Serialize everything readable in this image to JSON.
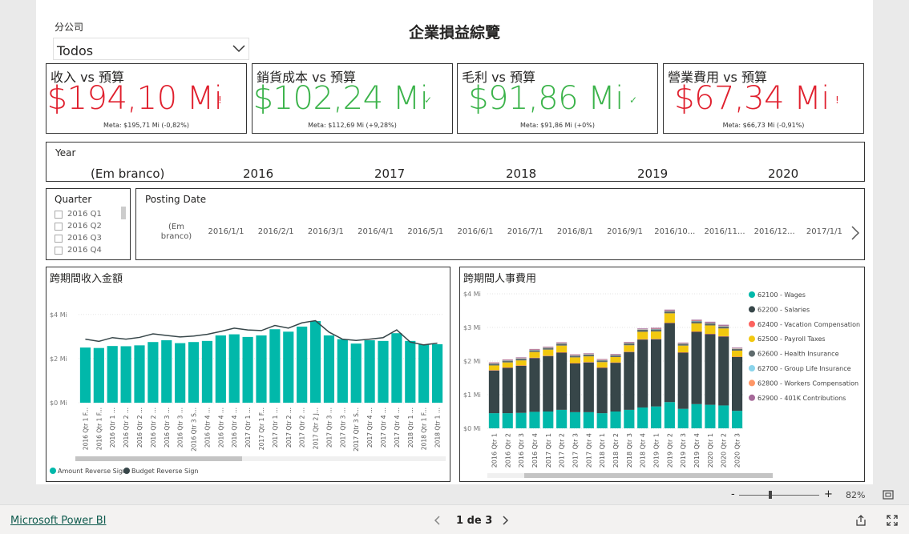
{
  "report": {
    "title": "企業損益綜覽",
    "subsidiary_label": "分公司",
    "subsidiary_value": "Todos"
  },
  "kpis": [
    {
      "title": "收入 vs 預算",
      "value": "$194,10 Mi",
      "mark": "!",
      "meta": "Meta: $195,71 Mi (-0,82%)",
      "color": "#e0202e"
    },
    {
      "title": "銷貨成本 vs 預算",
      "value": "$102,24 Mi",
      "mark": "✓",
      "meta": "Meta: $112,69 Mi (+9,28%)",
      "color": "#3bb34a"
    },
    {
      "title": "毛利 vs 預算",
      "value": "$91,86 Mi",
      "mark": "✓",
      "meta": "Meta: $91,86 Mi (+0%)",
      "color": "#3bb34a"
    },
    {
      "title": "營業費用 vs 預算",
      "value": "$67,34 Mi",
      "mark": "!",
      "meta": "Meta: $66,73 Mi (-0,91%)",
      "color": "#e0202e"
    }
  ],
  "year_slicer": {
    "title": "Year",
    "items": [
      "(Em branco)",
      "2016",
      "2017",
      "2018",
      "2019",
      "2020"
    ]
  },
  "quarter_slicer": {
    "title": "Quarter",
    "items": [
      "2016 Q1",
      "2016 Q2",
      "2016 Q3",
      "2016 Q4"
    ]
  },
  "date_slicer": {
    "title": "Posting Date",
    "items": [
      "(Em\nbranco)",
      "2016/1/1",
      "2016/2/1",
      "2016/3/1",
      "2016/4/1",
      "2016/5/1",
      "2016/6/1",
      "2016/7/1",
      "2016/8/1",
      "2016/9/1",
      "2016/10...",
      "2016/11...",
      "2016/12...",
      "2017/1/1"
    ]
  },
  "chart_data": [
    {
      "type": "bar",
      "title": "跨期間收入金額",
      "categories": [
        "2016 Qtr 1 F...",
        "2016 Qtr 1 F...",
        "2016 Qtr 1 ...",
        "2016 Qtr 2 ...",
        "2016 Qtr 2 ...",
        "2016 Qtr 2 ...",
        "2016 Qtr 3 ...",
        "2016 Qtr 3 ...",
        "2016 Qtr 3 S...",
        "2016 Qtr 4 ...",
        "2016 Qtr 4 ...",
        "2016 Qtr 4 ...",
        "2017 Qtr 1 ...",
        "2017 Qtr 1 F...",
        "2017 Qtr 1 ...",
        "2017 Qtr 2 ...",
        "2017 Qtr 2 ...",
        "2017 Qtr 2 J...",
        "2017 Qtr 3 ...",
        "2017 Qtr 3 ...",
        "2017 Qtr 3 S...",
        "2017 Qtr 4 ...",
        "2017 Qtr 4 ...",
        "2017 Qtr 4 ...",
        "2018 Qtr 1 ...",
        "2018 Qtr 1 F...",
        "2018 Qtr 1 ..."
      ],
      "series": [
        {
          "name": "Amount Reverse Sign",
          "values": [
            2.5,
            2.48,
            2.57,
            2.56,
            2.6,
            2.75,
            2.83,
            2.7,
            2.75,
            2.8,
            3.05,
            3.1,
            2.98,
            3.05,
            3.33,
            3.22,
            3.45,
            3.7,
            3.05,
            2.88,
            2.68,
            2.83,
            2.8,
            3.15,
            2.8,
            2.65,
            2.65
          ]
        },
        {
          "name": "Budget Reverse Sign",
          "values": [
            2.88,
            2.78,
            2.95,
            2.88,
            2.96,
            3.12,
            3.05,
            2.98,
            3.02,
            3.1,
            3.23,
            3.38,
            3.3,
            3.27,
            3.5,
            3.38,
            3.62,
            3.72,
            3.2,
            2.88,
            2.82,
            2.88,
            2.95,
            3.3,
            2.75,
            2.62,
            2.7
          ]
        }
      ],
      "yticks": [
        "$0 Mi",
        "$2 Mi",
        "$4 Mi"
      ],
      "ylim": [
        0,
        4.5
      ]
    },
    {
      "type": "bar",
      "stacked": true,
      "title": "跨期間人事費用",
      "categories": [
        "2016 Qtr 1",
        "2016 Qtr 2",
        "2016 Qtr 3",
        "2016 Qtr 4",
        "2017 Qtr 1",
        "2017 Qtr 2",
        "2017 Qtr 3",
        "2017 Qtr 4",
        "2018 Qtr 1",
        "2018 Qtr 2",
        "2018 Qtr 3",
        "2018 Qtr 4",
        "2019 Qtr 1",
        "2019 Qtr 2",
        "2019 Qtr 3",
        "2019 Qtr 4",
        "2020 Qtr 1",
        "2020 Qtr 2",
        "2020 Qtr 3"
      ],
      "series": [
        {
          "name": "62100 - Wages",
          "color": "#01b8aa",
          "values": [
            0.45,
            0.45,
            0.46,
            0.49,
            0.5,
            0.55,
            0.48,
            0.48,
            0.45,
            0.5,
            0.55,
            0.62,
            0.65,
            0.78,
            0.58,
            0.72,
            0.7,
            0.68,
            0.52
          ]
        },
        {
          "name": "62200 - Salaries",
          "color": "#374649",
          "values": [
            1.27,
            1.35,
            1.4,
            1.6,
            1.65,
            1.7,
            1.45,
            1.48,
            1.35,
            1.45,
            1.72,
            2.02,
            2.0,
            2.35,
            1.67,
            2.15,
            2.1,
            2.05,
            1.6
          ]
        },
        {
          "name": "62400 - Vacation Compensation",
          "color": "#fd625e",
          "values": [
            0.01,
            0.01,
            0.01,
            0.01,
            0.01,
            0.01,
            0.01,
            0.01,
            0.01,
            0.01,
            0.01,
            0.01,
            0.01,
            0.01,
            0.01,
            0.01,
            0.01,
            0.01,
            0.01
          ]
        },
        {
          "name": "62500 - Payroll Taxes",
          "color": "#f2c80f",
          "values": [
            0.14,
            0.15,
            0.15,
            0.17,
            0.18,
            0.2,
            0.17,
            0.17,
            0.16,
            0.16,
            0.19,
            0.22,
            0.22,
            0.28,
            0.2,
            0.24,
            0.25,
            0.23,
            0.18
          ]
        },
        {
          "name": "62600 - Health Insurance",
          "color": "#5f6b6d",
          "values": [
            0.05,
            0.05,
            0.05,
            0.05,
            0.05,
            0.06,
            0.05,
            0.05,
            0.05,
            0.05,
            0.06,
            0.06,
            0.06,
            0.06,
            0.05,
            0.06,
            0.06,
            0.06,
            0.05
          ]
        },
        {
          "name": "62700 - Group Life Insurance",
          "color": "#8ad4eb",
          "values": [
            0.01,
            0.01,
            0.01,
            0.01,
            0.01,
            0.01,
            0.01,
            0.01,
            0.01,
            0.01,
            0.01,
            0.01,
            0.01,
            0.01,
            0.01,
            0.01,
            0.01,
            0.01,
            0.01
          ]
        },
        {
          "name": "62800 - Workers Compensation",
          "color": "#fe9666",
          "values": [
            0.01,
            0.01,
            0.01,
            0.01,
            0.01,
            0.01,
            0.01,
            0.01,
            0.01,
            0.01,
            0.01,
            0.01,
            0.01,
            0.01,
            0.01,
            0.01,
            0.01,
            0.01,
            0.01
          ]
        },
        {
          "name": "62900 - 401K Contributions",
          "color": "#a66999",
          "values": [
            0.02,
            0.02,
            0.02,
            0.02,
            0.02,
            0.02,
            0.02,
            0.02,
            0.02,
            0.02,
            0.02,
            0.02,
            0.03,
            0.03,
            0.02,
            0.03,
            0.03,
            0.03,
            0.02
          ]
        }
      ],
      "yticks": [
        "$0 Mi",
        "$1 Mi",
        "$2 Mi",
        "$3 Mi",
        "$4 Mi"
      ],
      "ylim": [
        0,
        4
      ]
    }
  ],
  "status": {
    "zoom": "82%",
    "zoom_minus": "-",
    "zoom_plus": "+",
    "brand": "Microsoft Power BI",
    "page": "1 de 3"
  }
}
